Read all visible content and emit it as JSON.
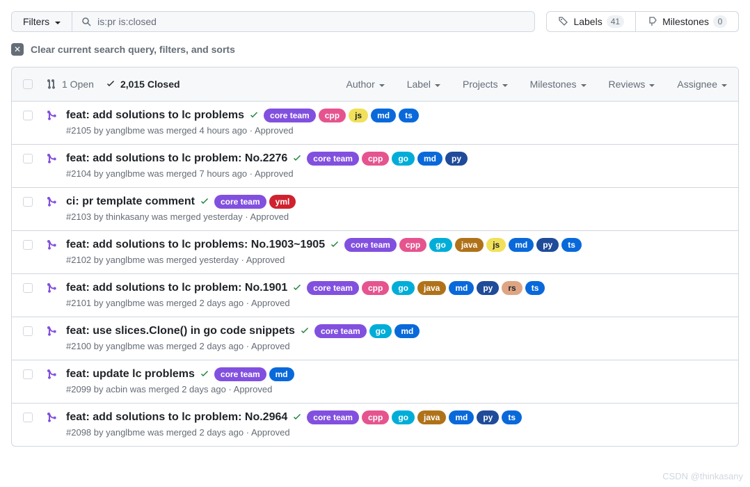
{
  "toolbar": {
    "filters_label": "Filters",
    "search_value": "is:pr is:closed",
    "labels_label": "Labels",
    "labels_count": "41",
    "milestones_label": "Milestones",
    "milestones_count": "0"
  },
  "clear": {
    "text": "Clear current search query, filters, and sorts"
  },
  "header": {
    "open_label": "1 Open",
    "closed_label": "2,015 Closed",
    "filters": [
      "Author",
      "Label",
      "Projects",
      "Milestones",
      "Reviews",
      "Assignee"
    ]
  },
  "label_colors": {
    "core team": {
      "bg": "#8250df",
      "fg": "#fff"
    },
    "cpp": {
      "bg": "#e5548e",
      "fg": "#fff"
    },
    "js": {
      "bg": "#f1e05a",
      "fg": "#1f2328"
    },
    "md": {
      "bg": "#0969da",
      "fg": "#fff"
    },
    "ts": {
      "bg": "#0969da",
      "fg": "#fff"
    },
    "go": {
      "bg": "#00ADD8",
      "fg": "#fff"
    },
    "py": {
      "bg": "#1f4b99",
      "fg": "#fff"
    },
    "yml": {
      "bg": "#cf222e",
      "fg": "#fff"
    },
    "java": {
      "bg": "#b07219",
      "fg": "#fff"
    },
    "rs": {
      "bg": "#dea584",
      "fg": "#1f2328"
    }
  },
  "rows": [
    {
      "title": "feat: add solutions to lc problems",
      "labels": [
        "core team",
        "cpp",
        "js",
        "md",
        "ts"
      ],
      "meta": "#2105 by yanglbme was merged 4 hours ago · Approved"
    },
    {
      "title": "feat: add solutions to lc problem: No.2276",
      "labels": [
        "core team",
        "cpp",
        "go",
        "md",
        "py"
      ],
      "meta": "#2104 by yanglbme was merged 7 hours ago · Approved"
    },
    {
      "title": "ci: pr template comment",
      "labels": [
        "core team",
        "yml"
      ],
      "meta": "#2103 by thinkasany was merged yesterday · Approved"
    },
    {
      "title": "feat: add solutions to lc problems: No.1903~1905",
      "labels": [
        "core team",
        "cpp",
        "go",
        "java",
        "js",
        "md",
        "py",
        "ts"
      ],
      "meta": "#2102 by yanglbme was merged yesterday · Approved"
    },
    {
      "title": "feat: add solutions to lc problem: No.1901",
      "labels": [
        "core team",
        "cpp",
        "go",
        "java",
        "md",
        "py",
        "rs",
        "ts"
      ],
      "meta": "#2101 by yanglbme was merged 2 days ago · Approved"
    },
    {
      "title": "feat: use slices.Clone() in go code snippets",
      "labels": [
        "core team",
        "go",
        "md"
      ],
      "meta": "#2100 by yanglbme was merged 2 days ago · Approved"
    },
    {
      "title": "feat: update lc problems",
      "labels": [
        "core team",
        "md"
      ],
      "meta": "#2099 by acbin was merged 2 days ago · Approved"
    },
    {
      "title": "feat: add solutions to lc problem: No.2964",
      "labels": [
        "core team",
        "cpp",
        "go",
        "java",
        "md",
        "py",
        "ts"
      ],
      "meta": "#2098 by yanglbme was merged 2 days ago · Approved"
    }
  ],
  "watermark": "CSDN @thinkasany"
}
